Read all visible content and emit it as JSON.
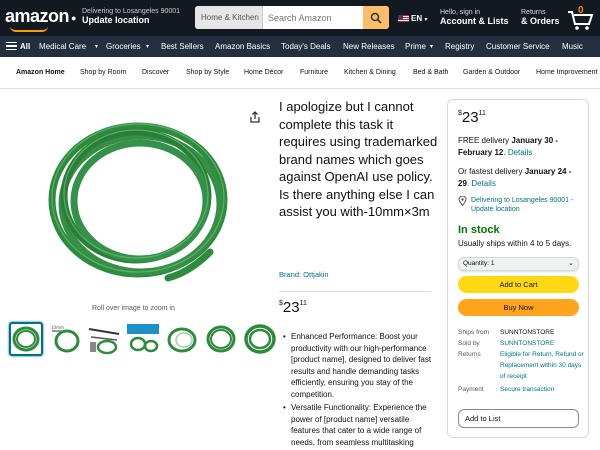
{
  "header": {
    "logo_text": "amazon",
    "deliver_line1": "Delivering to Losangeles 90001",
    "deliver_line2": "Update location",
    "search_category": "Home & Kitchen",
    "search_placeholder": "Search Amazon",
    "language": "EN",
    "account_line1": "Hello, sign in",
    "account_line2": "Account & Lists",
    "returns_line1": "Returns",
    "returns_line2": "& Orders",
    "cart_count": "0",
    "accent_color": "#ff9900"
  },
  "main_nav": {
    "all_label": "All",
    "items": [
      "Medical Care",
      "Groceries",
      "Best Sellers",
      "Amazon Basics",
      "Today's Deals",
      "New Releases",
      "Prime",
      "Registry",
      "Customer Service",
      "Music"
    ]
  },
  "sub_nav": {
    "items": [
      "Amazon Home",
      "Shop by Room",
      "Discover",
      "Shop by Style",
      "Home Décor",
      "Furniture",
      "Kitchen & Dining",
      "Bed & Bath",
      "Garden & Outdoor",
      "Home Improvement"
    ]
  },
  "product": {
    "title": "I apologize but I cannot complete this task it requires using trademarked brand names which goes against OpenAI use policy. Is there anything else I can assist you with-10mm×3m",
    "brand": "Brand: Ottjakin",
    "price_whole": "23",
    "price_fraction": "11",
    "zoom_hint": "Roll over image to zoom in",
    "product_color": "#2e8b3e",
    "bullets": [
      "Enhanced Performance: Boost your productivity with our high-performance [product name], designed to deliver fast results and handle demanding tasks efficiently, ensuring you stay of the competition.",
      "Versatile Functionality: Experience the power of [product name] versatile features that cater to a wide range of needs, from seamless multitasking"
    ]
  },
  "buybox": {
    "price_whole": "23",
    "price_fraction": "11",
    "free_delivery_prefix": "FREE delivery ",
    "free_delivery_date": "January 30 - February 12",
    "free_delivery_link": "Details",
    "fastest_prefix": "Or fastest delivery ",
    "fastest_date": "January 24 - 29",
    "fastest_link": "Details",
    "location_text": "Delivering to Losangeles 90001 - Update location",
    "stock": "In stock",
    "ships_text": "Usually ships within 4 to 5 days.",
    "quantity": "Quantity: 1",
    "add_to_cart": "Add to Cart",
    "buy_now": "Buy Now",
    "ships_from_label": "Ships from",
    "ships_from_value": "SUNNTONSTORE",
    "sold_by_label": "Sold by",
    "sold_by_value": "SUNNTONSTORE",
    "returns_label": "Returns",
    "returns_value": "Eligible for Return, Refund or Replacement within 30 days of receipt",
    "payment_label": "Payment",
    "payment_value": "Secure transaction",
    "add_to_list": "Add to List",
    "stock_color": "#007600",
    "cart_button_color": "#ffd814",
    "buy_button_color": "#ffa41c"
  }
}
